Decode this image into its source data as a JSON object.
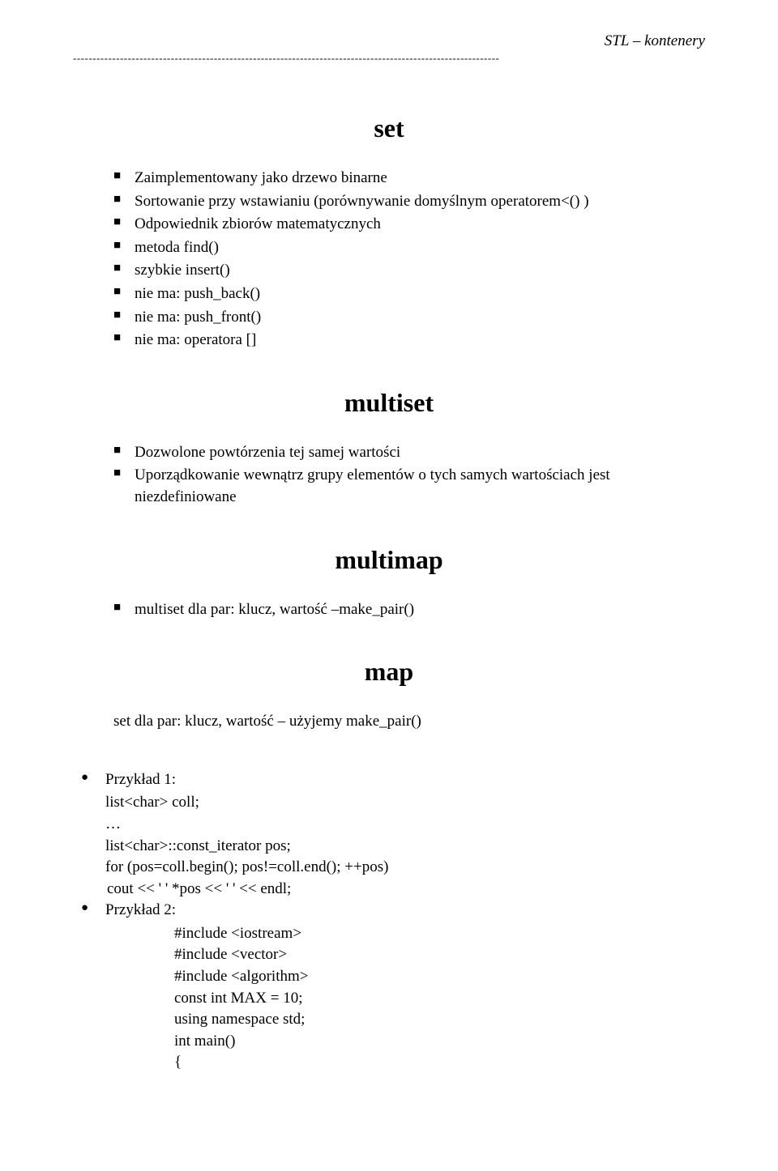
{
  "header": {
    "label": "STL – kontenery"
  },
  "sections": {
    "set": {
      "title": "set",
      "items": [
        "Zaimplementowany jako drzewo binarne",
        "Sortowanie przy wstawianiu (porównywanie domyślnym operatorem<() )",
        "Odpowiednik zbiorów matematycznych",
        "metoda find()",
        "szybkie insert()",
        "nie ma: push_back()",
        "nie ma: push_front()",
        "nie ma: operatora []"
      ]
    },
    "multiset": {
      "title": "multiset",
      "items": [
        "Dozwolone powtórzenia tej samej wartości",
        "Uporządkowanie wewnątrz grupy elementów o tych samych wartościach jest niezdefiniowane"
      ]
    },
    "multimap": {
      "title": "multimap",
      "items": [
        "multiset dla par: klucz, wartość –make_pair()"
      ]
    },
    "map": {
      "title": "map",
      "text": "set dla par: klucz, wartość – użyjemy make_pair()"
    }
  },
  "examples": {
    "ex1": {
      "label": "Przykład 1:",
      "lines": [
        "list<char> coll;",
        "…",
        "list<char>::const_iterator pos;",
        "for (pos=coll.begin(); pos!=coll.end(); ++pos)",
        " cout << ' ' *pos << ' ' << endl;"
      ]
    },
    "ex2": {
      "label": "Przykład 2:",
      "lines": [
        "#include <iostream>",
        "#include <vector>",
        "#include <algorithm>",
        "const int MAX = 10;",
        "using namespace std;",
        "int main()",
        "{"
      ]
    }
  }
}
